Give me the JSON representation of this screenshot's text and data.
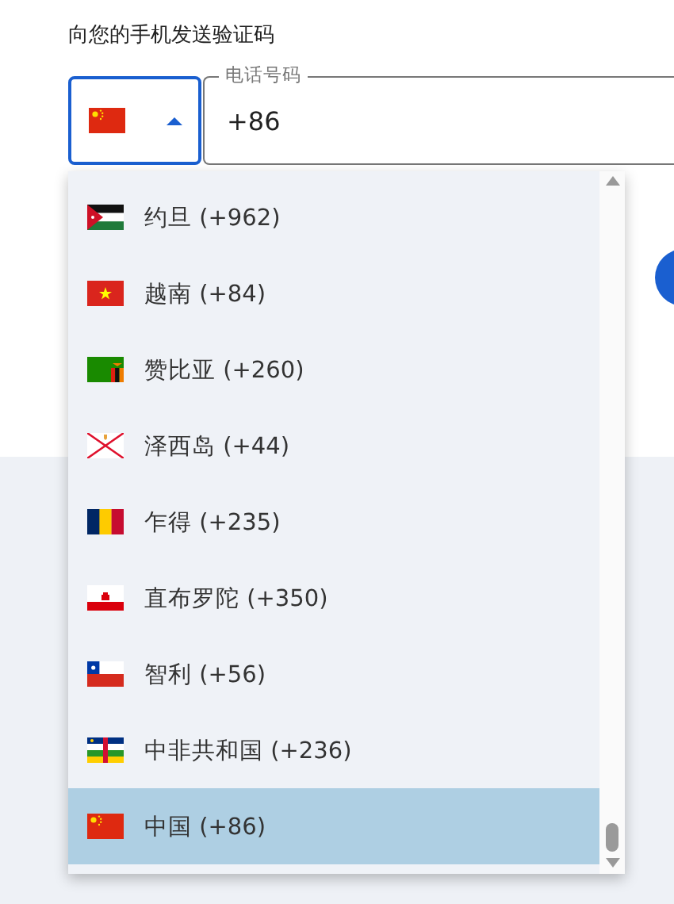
{
  "prompt": "向您的手机发送验证码",
  "phone_field": {
    "label": "电话号码",
    "value": "+86"
  },
  "country_picker": {
    "expanded": true
  },
  "countries": [
    {
      "label": "约旦 (+962)",
      "selected": false
    },
    {
      "label": "越南 (+84)",
      "selected": false
    },
    {
      "label": "赞比亚 (+260)",
      "selected": false
    },
    {
      "label": "泽西岛 (+44)",
      "selected": false
    },
    {
      "label": "乍得 (+235)",
      "selected": false
    },
    {
      "label": "直布罗陀 (+350)",
      "selected": false
    },
    {
      "label": "智利 (+56)",
      "selected": false
    },
    {
      "label": "中非共和国 (+236)",
      "selected": false
    },
    {
      "label": "中国 (+86)",
      "selected": true
    }
  ]
}
